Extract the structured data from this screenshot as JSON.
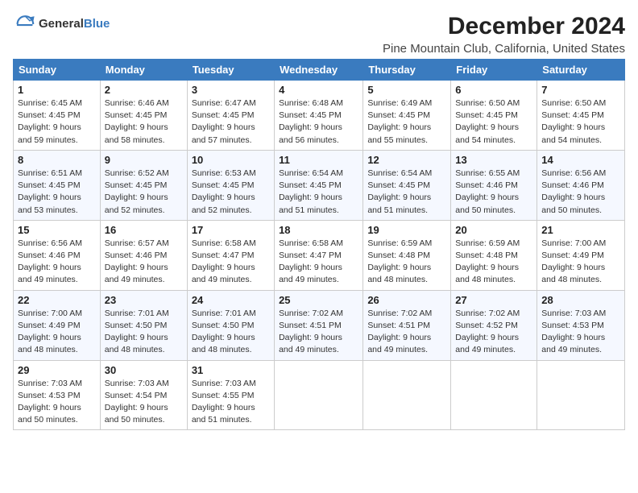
{
  "logo": {
    "general": "General",
    "blue": "Blue"
  },
  "title": "December 2024",
  "subtitle": "Pine Mountain Club, California, United States",
  "days_of_week": [
    "Sunday",
    "Monday",
    "Tuesday",
    "Wednesday",
    "Thursday",
    "Friday",
    "Saturday"
  ],
  "weeks": [
    [
      {
        "day": "1",
        "detail": "Sunrise: 6:45 AM\nSunset: 4:45 PM\nDaylight: 9 hours\nand 59 minutes."
      },
      {
        "day": "2",
        "detail": "Sunrise: 6:46 AM\nSunset: 4:45 PM\nDaylight: 9 hours\nand 58 minutes."
      },
      {
        "day": "3",
        "detail": "Sunrise: 6:47 AM\nSunset: 4:45 PM\nDaylight: 9 hours\nand 57 minutes."
      },
      {
        "day": "4",
        "detail": "Sunrise: 6:48 AM\nSunset: 4:45 PM\nDaylight: 9 hours\nand 56 minutes."
      },
      {
        "day": "5",
        "detail": "Sunrise: 6:49 AM\nSunset: 4:45 PM\nDaylight: 9 hours\nand 55 minutes."
      },
      {
        "day": "6",
        "detail": "Sunrise: 6:50 AM\nSunset: 4:45 PM\nDaylight: 9 hours\nand 54 minutes."
      },
      {
        "day": "7",
        "detail": "Sunrise: 6:50 AM\nSunset: 4:45 PM\nDaylight: 9 hours\nand 54 minutes."
      }
    ],
    [
      {
        "day": "8",
        "detail": "Sunrise: 6:51 AM\nSunset: 4:45 PM\nDaylight: 9 hours\nand 53 minutes."
      },
      {
        "day": "9",
        "detail": "Sunrise: 6:52 AM\nSunset: 4:45 PM\nDaylight: 9 hours\nand 52 minutes."
      },
      {
        "day": "10",
        "detail": "Sunrise: 6:53 AM\nSunset: 4:45 PM\nDaylight: 9 hours\nand 52 minutes."
      },
      {
        "day": "11",
        "detail": "Sunrise: 6:54 AM\nSunset: 4:45 PM\nDaylight: 9 hours\nand 51 minutes."
      },
      {
        "day": "12",
        "detail": "Sunrise: 6:54 AM\nSunset: 4:45 PM\nDaylight: 9 hours\nand 51 minutes."
      },
      {
        "day": "13",
        "detail": "Sunrise: 6:55 AM\nSunset: 4:46 PM\nDaylight: 9 hours\nand 50 minutes."
      },
      {
        "day": "14",
        "detail": "Sunrise: 6:56 AM\nSunset: 4:46 PM\nDaylight: 9 hours\nand 50 minutes."
      }
    ],
    [
      {
        "day": "15",
        "detail": "Sunrise: 6:56 AM\nSunset: 4:46 PM\nDaylight: 9 hours\nand 49 minutes."
      },
      {
        "day": "16",
        "detail": "Sunrise: 6:57 AM\nSunset: 4:46 PM\nDaylight: 9 hours\nand 49 minutes."
      },
      {
        "day": "17",
        "detail": "Sunrise: 6:58 AM\nSunset: 4:47 PM\nDaylight: 9 hours\nand 49 minutes."
      },
      {
        "day": "18",
        "detail": "Sunrise: 6:58 AM\nSunset: 4:47 PM\nDaylight: 9 hours\nand 49 minutes."
      },
      {
        "day": "19",
        "detail": "Sunrise: 6:59 AM\nSunset: 4:48 PM\nDaylight: 9 hours\nand 48 minutes."
      },
      {
        "day": "20",
        "detail": "Sunrise: 6:59 AM\nSunset: 4:48 PM\nDaylight: 9 hours\nand 48 minutes."
      },
      {
        "day": "21",
        "detail": "Sunrise: 7:00 AM\nSunset: 4:49 PM\nDaylight: 9 hours\nand 48 minutes."
      }
    ],
    [
      {
        "day": "22",
        "detail": "Sunrise: 7:00 AM\nSunset: 4:49 PM\nDaylight: 9 hours\nand 48 minutes."
      },
      {
        "day": "23",
        "detail": "Sunrise: 7:01 AM\nSunset: 4:50 PM\nDaylight: 9 hours\nand 48 minutes."
      },
      {
        "day": "24",
        "detail": "Sunrise: 7:01 AM\nSunset: 4:50 PM\nDaylight: 9 hours\nand 48 minutes."
      },
      {
        "day": "25",
        "detail": "Sunrise: 7:02 AM\nSunset: 4:51 PM\nDaylight: 9 hours\nand 49 minutes."
      },
      {
        "day": "26",
        "detail": "Sunrise: 7:02 AM\nSunset: 4:51 PM\nDaylight: 9 hours\nand 49 minutes."
      },
      {
        "day": "27",
        "detail": "Sunrise: 7:02 AM\nSunset: 4:52 PM\nDaylight: 9 hours\nand 49 minutes."
      },
      {
        "day": "28",
        "detail": "Sunrise: 7:03 AM\nSunset: 4:53 PM\nDaylight: 9 hours\nand 49 minutes."
      }
    ],
    [
      {
        "day": "29",
        "detail": "Sunrise: 7:03 AM\nSunset: 4:53 PM\nDaylight: 9 hours\nand 50 minutes."
      },
      {
        "day": "30",
        "detail": "Sunrise: 7:03 AM\nSunset: 4:54 PM\nDaylight: 9 hours\nand 50 minutes."
      },
      {
        "day": "31",
        "detail": "Sunrise: 7:03 AM\nSunset: 4:55 PM\nDaylight: 9 hours\nand 51 minutes."
      },
      {
        "day": "",
        "detail": ""
      },
      {
        "day": "",
        "detail": ""
      },
      {
        "day": "",
        "detail": ""
      },
      {
        "day": "",
        "detail": ""
      }
    ]
  ]
}
